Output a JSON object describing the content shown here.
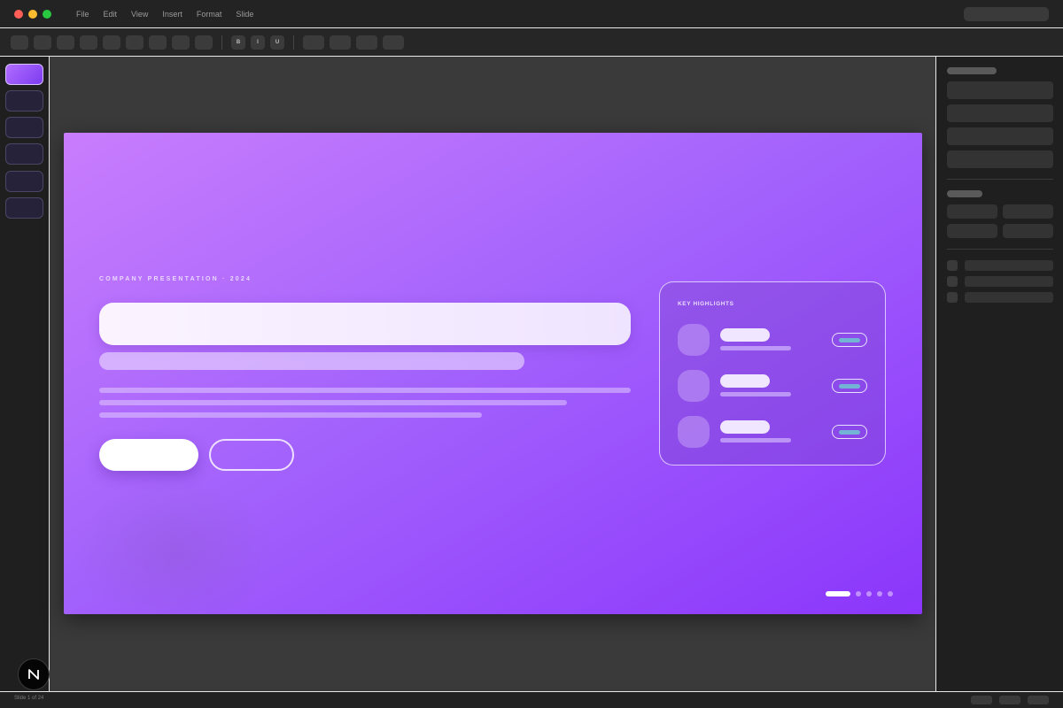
{
  "window": {
    "traffic_lights": {
      "close": "#ff5f57",
      "minimize": "#febc2e",
      "maximize": "#28c840"
    }
  },
  "menu": [
    "File",
    "Edit",
    "View",
    "Insert",
    "Format",
    "Slide"
  ],
  "toolbar": {
    "format_buttons": [
      "B",
      "I",
      "U"
    ]
  },
  "slides_panel": {
    "count_visible": 6,
    "active_index": 0
  },
  "slide": {
    "eyebrow": "COMPANY PRESENTATION · 2024",
    "card": {
      "label": "KEY HIGHLIGHTS",
      "rows": 3
    },
    "pagination": {
      "total": 5,
      "active": 0
    },
    "colors": {
      "gradient_start": "#c97dfd",
      "gradient_end": "#8b36fb",
      "badge_accent": "#72b3d6"
    }
  },
  "status": {
    "slide_indicator": "Slide 1 of 24"
  },
  "logo": {
    "icon": "n-logo-icon"
  }
}
